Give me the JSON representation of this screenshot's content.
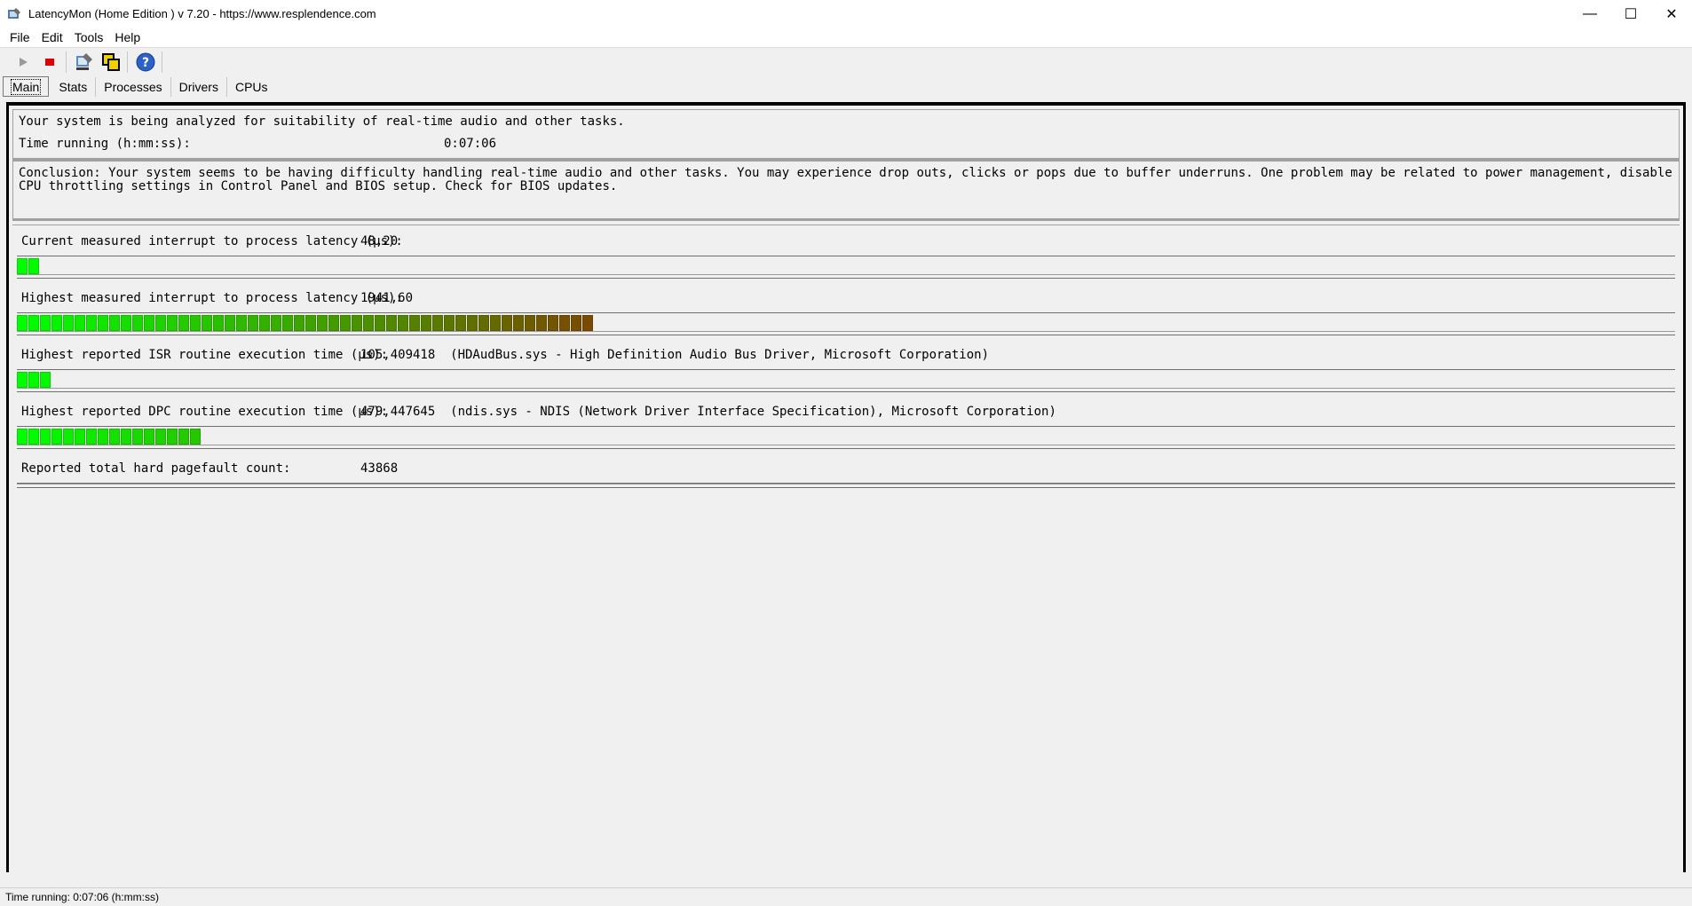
{
  "window": {
    "title": "LatencyMon  (Home Edition )  v 7.20 - https://www.resplendence.com",
    "minimize": "—",
    "maximize": "☐",
    "close": "✕"
  },
  "menu": {
    "file": "File",
    "edit": "Edit",
    "tools": "Tools",
    "help": "Help"
  },
  "tabs": {
    "main": "Main",
    "stats": "Stats",
    "processes": "Processes",
    "drivers": "Drivers",
    "cpus": "CPUs"
  },
  "summary": {
    "analyzing": "Your system is being analyzed for suitability of real-time audio and other tasks.",
    "time_label": "Time running (h:mm:ss):",
    "time_value": "0:07:06"
  },
  "conclusion": "Conclusion: Your system seems to be having difficulty handling real-time audio and other tasks. You may experience drop outs, clicks or pops due to buffer underruns. One problem may be related to power management, disable CPU throttling settings in Control Panel and BIOS setup. Check for BIOS updates.",
  "metrics": [
    {
      "label": "Current measured interrupt to process latency (µs):",
      "value": "48,20",
      "segments": 2
    },
    {
      "label": "Highest measured interrupt to process latency (µs):",
      "value": "1941,60",
      "segments": 50
    },
    {
      "label": "Highest reported ISR routine execution time (µs):",
      "value": "105,409418  (HDAudBus.sys - High Definition Audio Bus Driver, Microsoft Corporation)",
      "segments": 3
    },
    {
      "label": "Highest reported DPC routine execution time (µs):",
      "value": "479,447645  (ndis.sys - NDIS (Network Driver Interface Specification), Microsoft Corporation)",
      "segments": 16
    },
    {
      "label": "Reported total hard pagefault count:",
      "value": "43868"
    }
  ],
  "status": "Time running: 0:07:06  (h:mm:ss)",
  "colors": {
    "bar_start": "#00ff00",
    "bar_end": "#7a4a00"
  }
}
